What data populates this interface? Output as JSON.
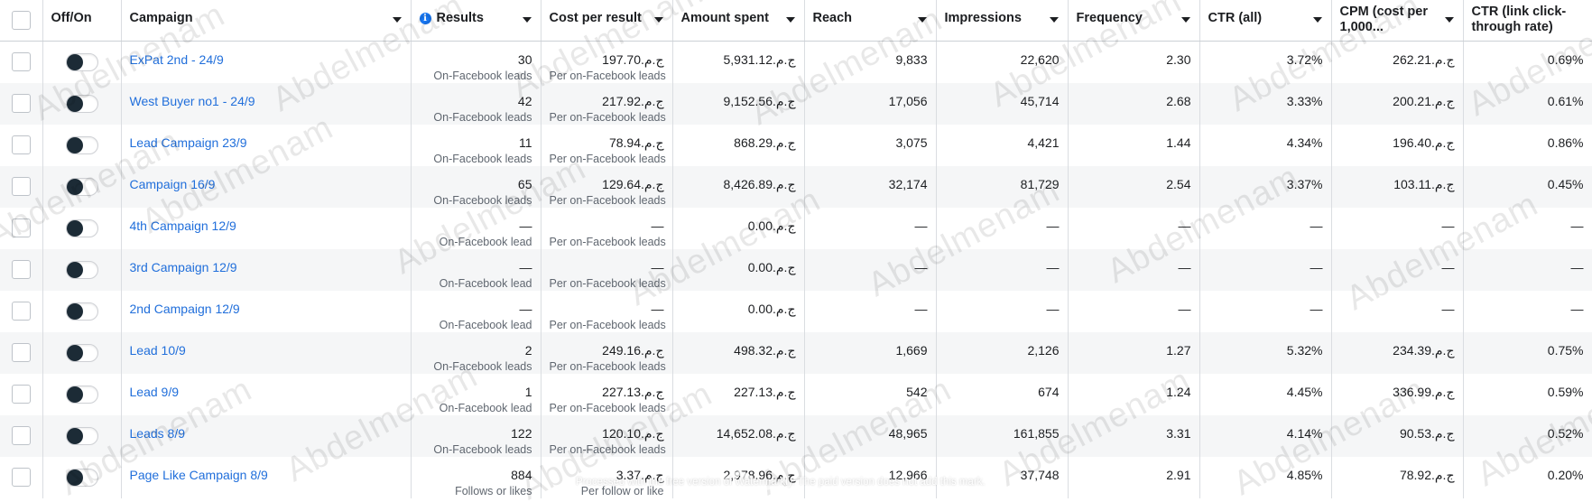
{
  "columns": {
    "offon": "Off/On",
    "campaign": "Campaign",
    "results": "Results",
    "cost_per_result": "Cost per result",
    "amount_spent": "Amount spent",
    "reach": "Reach",
    "impressions": "Impressions",
    "frequency": "Frequency",
    "ctr_all": "CTR (all)",
    "cpm": "CPM (cost per 1,000...",
    "ctr_link": "CTR (link click-through rate)"
  },
  "rows": [
    {
      "name": "ExPat 2nd - 24/9",
      "results": "30",
      "results_sub": "On-Facebook leads",
      "cpr": "197.70.ج.م",
      "cpr_sub": "Per on-Facebook leads",
      "spent": "5,931.12.ج.م",
      "reach": "9,833",
      "impr": "22,620",
      "freq": "2.30",
      "ctr": "3.72%",
      "cpm": "262.21.ج.م",
      "ctrl": "0.69%"
    },
    {
      "name": "West Buyer no1 - 24/9",
      "results": "42",
      "results_sub": "On-Facebook leads",
      "cpr": "217.92.ج.م",
      "cpr_sub": "Per on-Facebook leads",
      "spent": "9,152.56.ج.م",
      "reach": "17,056",
      "impr": "45,714",
      "freq": "2.68",
      "ctr": "3.33%",
      "cpm": "200.21.ج.م",
      "ctrl": "0.61%"
    },
    {
      "name": "Lead Campaign 23/9",
      "results": "11",
      "results_sub": "On-Facebook leads",
      "cpr": "78.94.ج.م",
      "cpr_sub": "Per on-Facebook leads",
      "spent": "868.29.ج.م",
      "reach": "3,075",
      "impr": "4,421",
      "freq": "1.44",
      "ctr": "4.34%",
      "cpm": "196.40.ج.م",
      "ctrl": "0.86%"
    },
    {
      "name": "Campaign 16/9",
      "results": "65",
      "results_sub": "On-Facebook leads",
      "cpr": "129.64.ج.م",
      "cpr_sub": "Per on-Facebook leads",
      "spent": "8,426.89.ج.م",
      "reach": "32,174",
      "impr": "81,729",
      "freq": "2.54",
      "ctr": "3.37%",
      "cpm": "103.11.ج.م",
      "ctrl": "0.45%"
    },
    {
      "name": "4th Campaign 12/9",
      "results": "—",
      "results_sub": "On-Facebook lead",
      "cpr": "—",
      "cpr_sub": "Per on-Facebook leads",
      "spent": "0.00.ج.م",
      "reach": "—",
      "impr": "—",
      "freq": "—",
      "ctr": "—",
      "cpm": "—",
      "ctrl": "—"
    },
    {
      "name": "3rd Campaign 12/9",
      "results": "—",
      "results_sub": "On-Facebook lead",
      "cpr": "—",
      "cpr_sub": "Per on-Facebook leads",
      "spent": "0.00.ج.م",
      "reach": "—",
      "impr": "—",
      "freq": "—",
      "ctr": "—",
      "cpm": "—",
      "ctrl": "—"
    },
    {
      "name": "2nd Campaign 12/9",
      "results": "—",
      "results_sub": "On-Facebook lead",
      "cpr": "—",
      "cpr_sub": "Per on-Facebook leads",
      "spent": "0.00.ج.م",
      "reach": "—",
      "impr": "—",
      "freq": "—",
      "ctr": "—",
      "cpm": "—",
      "ctrl": "—"
    },
    {
      "name": "Lead 10/9",
      "results": "2",
      "results_sub": "On-Facebook leads",
      "cpr": "249.16.ج.م",
      "cpr_sub": "Per on-Facebook leads",
      "spent": "498.32.ج.م",
      "reach": "1,669",
      "impr": "2,126",
      "freq": "1.27",
      "ctr": "5.32%",
      "cpm": "234.39.ج.م",
      "ctrl": "0.75%"
    },
    {
      "name": "Lead 9/9",
      "results": "1",
      "results_sub": "On-Facebook lead",
      "cpr": "227.13.ج.م",
      "cpr_sub": "Per on-Facebook leads",
      "spent": "227.13.ج.م",
      "reach": "542",
      "impr": "674",
      "freq": "1.24",
      "ctr": "4.45%",
      "cpm": "336.99.ج.م",
      "ctrl": "0.59%"
    },
    {
      "name": "Leads 8/9",
      "results": "122",
      "results_sub": "On-Facebook leads",
      "cpr": "120.10.ج.م",
      "cpr_sub": "Per on-Facebook leads",
      "spent": "14,652.08.ج.م",
      "reach": "48,965",
      "impr": "161,855",
      "freq": "3.31",
      "ctr": "4.14%",
      "cpm": "90.53.ج.م",
      "ctrl": "0.52%"
    },
    {
      "name": "Page Like Campaign 8/9",
      "results": "884",
      "results_sub": "Follows or likes",
      "cpr": "3.37.ج.م",
      "cpr_sub": "Per follow or like",
      "spent": "2,978.96.ج.م",
      "reach": "12,966",
      "impr": "37,748",
      "freq": "2.91",
      "ctr": "4.85%",
      "cpm": "78.92.ج.م",
      "ctrl": "0.20%"
    }
  ],
  "watermark": {
    "text": "Abdelmenam",
    "note": "Processed with the free version of Watermarkly. The paid version does not add this mark."
  },
  "colors": {
    "link": "#216fdb",
    "stripe": "#f5f6f7",
    "border": "#dadde1",
    "toggle_knob": "#1c2b36",
    "info": "#1877f2"
  }
}
